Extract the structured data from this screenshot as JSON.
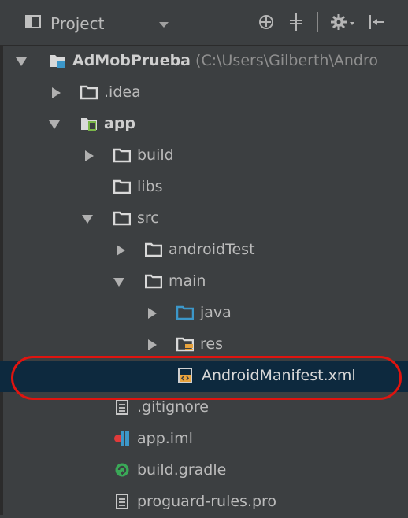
{
  "toolbar": {
    "view_label": "Project",
    "icons": [
      "project-view-icon",
      "locate-icon",
      "collapse-all-icon",
      "settings-gear-icon",
      "hide-panel-icon"
    ]
  },
  "tree": {
    "root": {
      "name": "AdMobPrueba",
      "path": "(C:\\Users\\Gilberth\\Andro"
    },
    "idea": ".idea",
    "app": "app",
    "build": "build",
    "libs": "libs",
    "src": "src",
    "androidTest": "androidTest",
    "main": "main",
    "java": "java",
    "res": "res",
    "manifest": "AndroidManifest.xml",
    "gitignore": ".gitignore",
    "appiml": "app.iml",
    "buildgradle": "build.gradle",
    "proguard": "proguard-rules.pro"
  },
  "colors": {
    "background": "#3c3f41",
    "selection": "#0d293e",
    "folder": "#d9d9d9",
    "source_folder": "#3c97c9",
    "highlight_ring": "#e0140f"
  }
}
